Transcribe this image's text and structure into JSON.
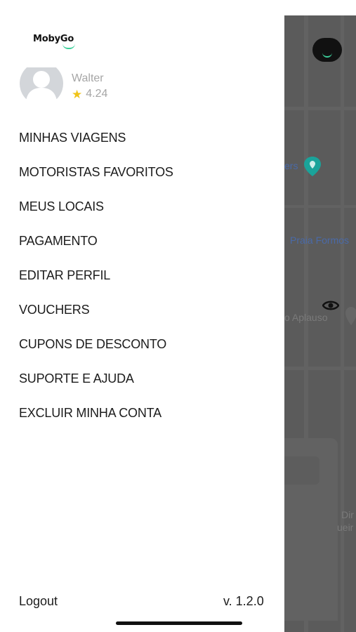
{
  "drawer": {
    "brand": "MobyGo",
    "user": {
      "name": "Walter",
      "rating": "4.24"
    },
    "menu": [
      {
        "label": "MINHAS VIAGENS"
      },
      {
        "label": "MOTORISTAS FAVORITOS"
      },
      {
        "label": "MEUS LOCAIS"
      },
      {
        "label": "PAGAMENTO"
      },
      {
        "label": "EDITAR PERFIL"
      },
      {
        "label": "VOUCHERS"
      },
      {
        "label": "CUPONS DE DESCONTO"
      },
      {
        "label": "SUPORTE E AJUDA"
      },
      {
        "label": "EXCLUIR MINHA CONTA"
      }
    ],
    "logout_label": "Logout",
    "version": "v. 1.2.0"
  },
  "map": {
    "badge_letter": "m",
    "labels": {
      "place_1": "ers",
      "place_2": "Praia Formos",
      "place_3": "o Aplauso",
      "card_1": "Dir",
      "card_2": "ueir"
    }
  },
  "colors": {
    "accent": "#3ccf9a",
    "star": "#f0c419",
    "map_label_blue": "#4a6aa8",
    "pin_teal": "#1aa39a"
  },
  "icons": [
    "map-pin-icon",
    "eye-icon",
    "star-icon",
    "avatar-placeholder-icon"
  ]
}
